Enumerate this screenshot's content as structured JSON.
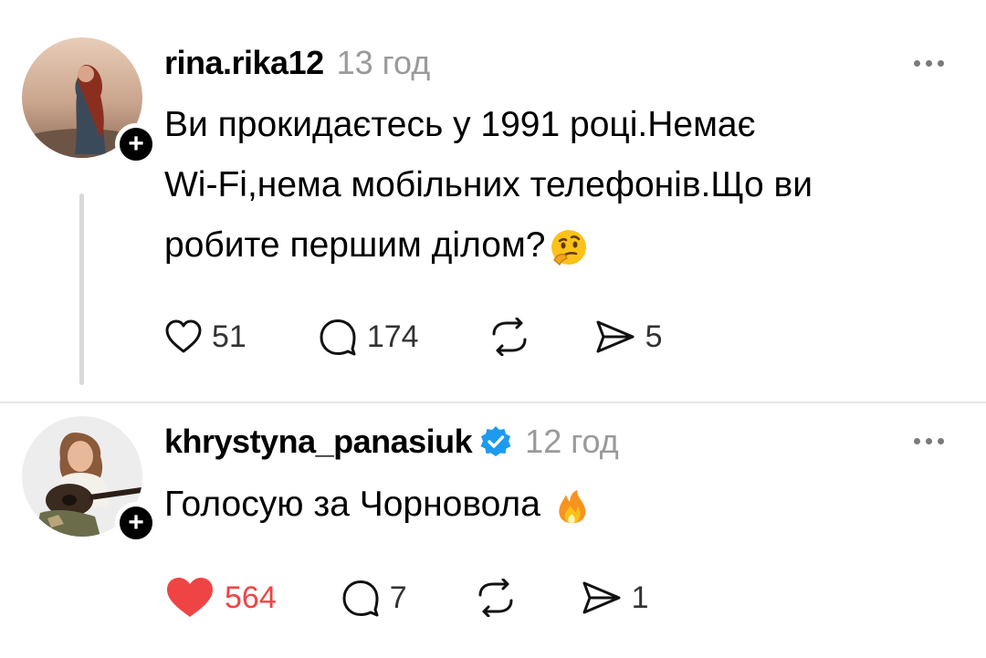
{
  "posts": [
    {
      "username": "rina.rika12",
      "time": "13 год",
      "verified": false,
      "text_line1": "Ви прокидаєтесь у 1991 році.Немає",
      "text_line2": "Wi-Fi,нема мобільних телефонів.Що ви",
      "text_line3": "робите першим ділом?",
      "emoji": "thinking-face-emoji",
      "likes": "51",
      "replies": "174",
      "reposts": "",
      "shares": "5",
      "liked": false
    },
    {
      "username": "khrystyna_panasiuk",
      "time": "12 год",
      "verified": true,
      "text_line1": "Голосую за Чорновола",
      "emoji": "fire-emoji",
      "likes": "564",
      "replies": "7",
      "reposts": "",
      "shares": "1",
      "liked": true
    }
  ],
  "colors": {
    "like_active": "#ef4444",
    "verified_badge": "#1d9bf0",
    "muted_text": "#9a9a9a",
    "thread_line": "#d9d9d9"
  }
}
